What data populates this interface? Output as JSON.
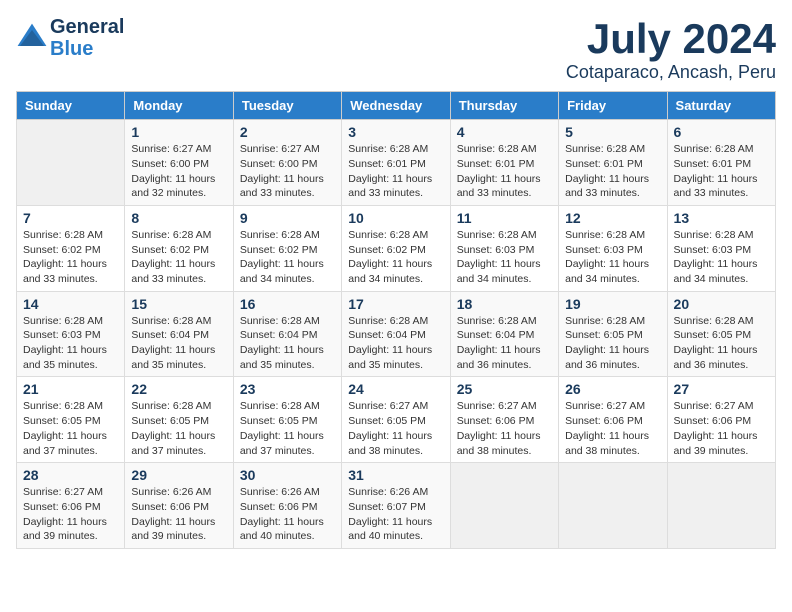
{
  "logo": {
    "line1": "General",
    "line2": "Blue"
  },
  "title": "July 2024",
  "subtitle": "Cotaparaco, Ancash, Peru",
  "calendar": {
    "headers": [
      "Sunday",
      "Monday",
      "Tuesday",
      "Wednesday",
      "Thursday",
      "Friday",
      "Saturday"
    ],
    "weeks": [
      [
        {
          "day": "",
          "info": ""
        },
        {
          "day": "1",
          "info": "Sunrise: 6:27 AM\nSunset: 6:00 PM\nDaylight: 11 hours\nand 32 minutes."
        },
        {
          "day": "2",
          "info": "Sunrise: 6:27 AM\nSunset: 6:00 PM\nDaylight: 11 hours\nand 33 minutes."
        },
        {
          "day": "3",
          "info": "Sunrise: 6:28 AM\nSunset: 6:01 PM\nDaylight: 11 hours\nand 33 minutes."
        },
        {
          "day": "4",
          "info": "Sunrise: 6:28 AM\nSunset: 6:01 PM\nDaylight: 11 hours\nand 33 minutes."
        },
        {
          "day": "5",
          "info": "Sunrise: 6:28 AM\nSunset: 6:01 PM\nDaylight: 11 hours\nand 33 minutes."
        },
        {
          "day": "6",
          "info": "Sunrise: 6:28 AM\nSunset: 6:01 PM\nDaylight: 11 hours\nand 33 minutes."
        }
      ],
      [
        {
          "day": "7",
          "info": "Sunrise: 6:28 AM\nSunset: 6:02 PM\nDaylight: 11 hours\nand 33 minutes."
        },
        {
          "day": "8",
          "info": "Sunrise: 6:28 AM\nSunset: 6:02 PM\nDaylight: 11 hours\nand 33 minutes."
        },
        {
          "day": "9",
          "info": "Sunrise: 6:28 AM\nSunset: 6:02 PM\nDaylight: 11 hours\nand 34 minutes."
        },
        {
          "day": "10",
          "info": "Sunrise: 6:28 AM\nSunset: 6:02 PM\nDaylight: 11 hours\nand 34 minutes."
        },
        {
          "day": "11",
          "info": "Sunrise: 6:28 AM\nSunset: 6:03 PM\nDaylight: 11 hours\nand 34 minutes."
        },
        {
          "day": "12",
          "info": "Sunrise: 6:28 AM\nSunset: 6:03 PM\nDaylight: 11 hours\nand 34 minutes."
        },
        {
          "day": "13",
          "info": "Sunrise: 6:28 AM\nSunset: 6:03 PM\nDaylight: 11 hours\nand 34 minutes."
        }
      ],
      [
        {
          "day": "14",
          "info": "Sunrise: 6:28 AM\nSunset: 6:03 PM\nDaylight: 11 hours\nand 35 minutes."
        },
        {
          "day": "15",
          "info": "Sunrise: 6:28 AM\nSunset: 6:04 PM\nDaylight: 11 hours\nand 35 minutes."
        },
        {
          "day": "16",
          "info": "Sunrise: 6:28 AM\nSunset: 6:04 PM\nDaylight: 11 hours\nand 35 minutes."
        },
        {
          "day": "17",
          "info": "Sunrise: 6:28 AM\nSunset: 6:04 PM\nDaylight: 11 hours\nand 35 minutes."
        },
        {
          "day": "18",
          "info": "Sunrise: 6:28 AM\nSunset: 6:04 PM\nDaylight: 11 hours\nand 36 minutes."
        },
        {
          "day": "19",
          "info": "Sunrise: 6:28 AM\nSunset: 6:05 PM\nDaylight: 11 hours\nand 36 minutes."
        },
        {
          "day": "20",
          "info": "Sunrise: 6:28 AM\nSunset: 6:05 PM\nDaylight: 11 hours\nand 36 minutes."
        }
      ],
      [
        {
          "day": "21",
          "info": "Sunrise: 6:28 AM\nSunset: 6:05 PM\nDaylight: 11 hours\nand 37 minutes."
        },
        {
          "day": "22",
          "info": "Sunrise: 6:28 AM\nSunset: 6:05 PM\nDaylight: 11 hours\nand 37 minutes."
        },
        {
          "day": "23",
          "info": "Sunrise: 6:28 AM\nSunset: 6:05 PM\nDaylight: 11 hours\nand 37 minutes."
        },
        {
          "day": "24",
          "info": "Sunrise: 6:27 AM\nSunset: 6:05 PM\nDaylight: 11 hours\nand 38 minutes."
        },
        {
          "day": "25",
          "info": "Sunrise: 6:27 AM\nSunset: 6:06 PM\nDaylight: 11 hours\nand 38 minutes."
        },
        {
          "day": "26",
          "info": "Sunrise: 6:27 AM\nSunset: 6:06 PM\nDaylight: 11 hours\nand 38 minutes."
        },
        {
          "day": "27",
          "info": "Sunrise: 6:27 AM\nSunset: 6:06 PM\nDaylight: 11 hours\nand 39 minutes."
        }
      ],
      [
        {
          "day": "28",
          "info": "Sunrise: 6:27 AM\nSunset: 6:06 PM\nDaylight: 11 hours\nand 39 minutes."
        },
        {
          "day": "29",
          "info": "Sunrise: 6:26 AM\nSunset: 6:06 PM\nDaylight: 11 hours\nand 39 minutes."
        },
        {
          "day": "30",
          "info": "Sunrise: 6:26 AM\nSunset: 6:06 PM\nDaylight: 11 hours\nand 40 minutes."
        },
        {
          "day": "31",
          "info": "Sunrise: 6:26 AM\nSunset: 6:07 PM\nDaylight: 11 hours\nand 40 minutes."
        },
        {
          "day": "",
          "info": ""
        },
        {
          "day": "",
          "info": ""
        },
        {
          "day": "",
          "info": ""
        }
      ]
    ]
  }
}
